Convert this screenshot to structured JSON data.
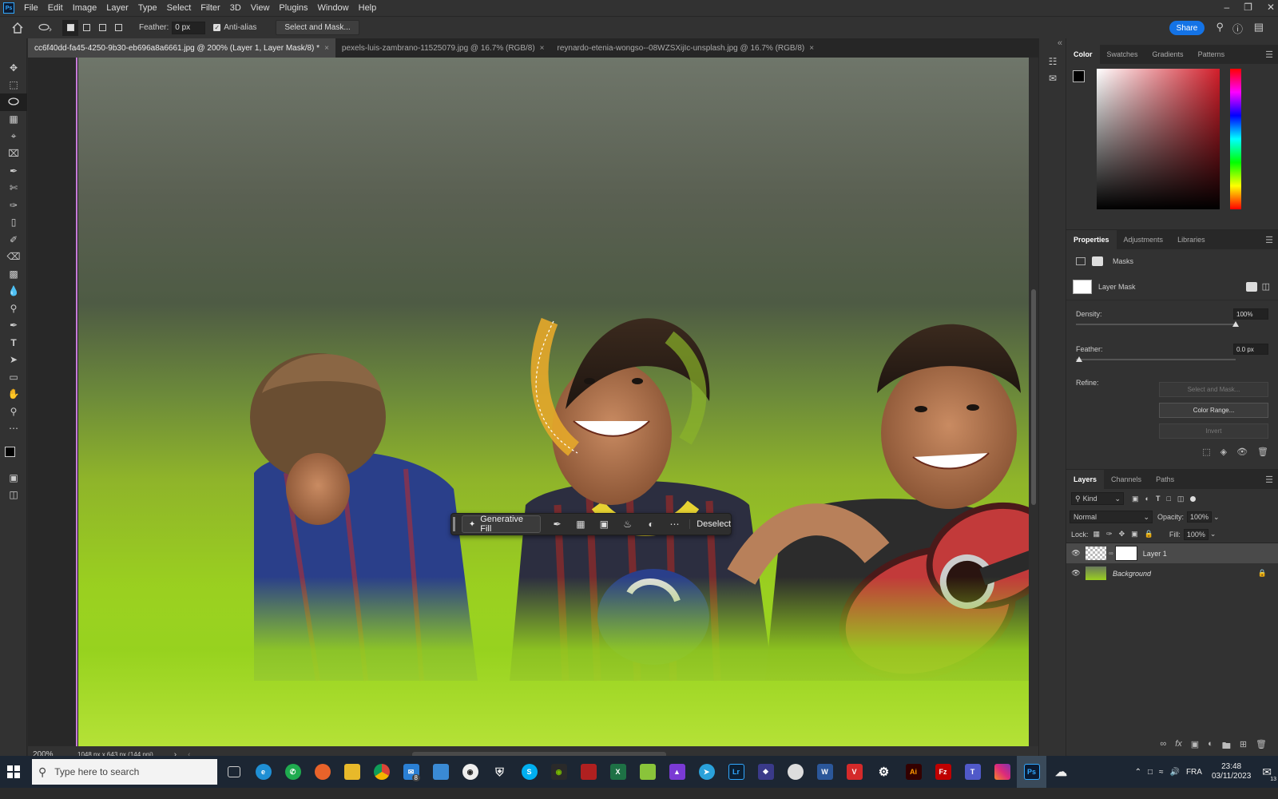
{
  "menubar": {
    "app_badge": "Ps",
    "items": [
      "File",
      "Edit",
      "Image",
      "Layer",
      "Type",
      "Select",
      "Filter",
      "3D",
      "View",
      "Plugins",
      "Window",
      "Help"
    ]
  },
  "options": {
    "feather_label": "Feather:",
    "feather_value": "0 px",
    "antialias_label": "Anti-alias",
    "select_mask_label": "Select and Mask...",
    "share_label": "Share"
  },
  "tabs": [
    {
      "label": "cc6f40dd-fa45-4250-9b30-eb696a8a6661.jpg @ 200% (Layer 1, Layer Mask/8) *"
    },
    {
      "label": "pexels-luis-zambrano-11525079.jpg @ 16.7% (RGB/8)"
    },
    {
      "label": "reynardo-etenia-wongso--08WZSXijIc-unsplash.jpg @ 16.7% (RGB/8)"
    }
  ],
  "contextbar": {
    "generative_fill": "Generative Fill",
    "deselect": "Deselect",
    "more": "⋯"
  },
  "status": {
    "zoom": "200%",
    "doc_info": "1048 px x 643 px (144 ppi)"
  },
  "color_panel": {
    "tabs": [
      "Color",
      "Swatches",
      "Gradients",
      "Patterns"
    ]
  },
  "properties_panel": {
    "tabs": [
      "Properties",
      "Adjustments",
      "Libraries"
    ],
    "masks_label": "Masks",
    "layer_mask_label": "Layer Mask",
    "density_label": "Density:",
    "density_value": "100%",
    "feather_label": "Feather:",
    "feather_value": "0.0 px",
    "refine_label": "Refine:",
    "select_and_mask": "Select and Mask...",
    "color_range": "Color Range...",
    "invert": "Invert"
  },
  "layers_panel": {
    "tabs": [
      "Layers",
      "Channels",
      "Paths"
    ],
    "kind_label": "Kind",
    "blend_mode": "Normal",
    "opacity_label": "Opacity:",
    "opacity_value": "100%",
    "lock_label": "Lock:",
    "fill_label": "Fill:",
    "fill_value": "100%",
    "layers": [
      {
        "name": "Layer 1"
      },
      {
        "name": "Background"
      }
    ]
  },
  "taskbar": {
    "search_placeholder": "Type here to search",
    "lang": "FRA",
    "time": "23:48",
    "date": "03/11/2023",
    "notif_count": "13",
    "mail_badge": "8"
  }
}
